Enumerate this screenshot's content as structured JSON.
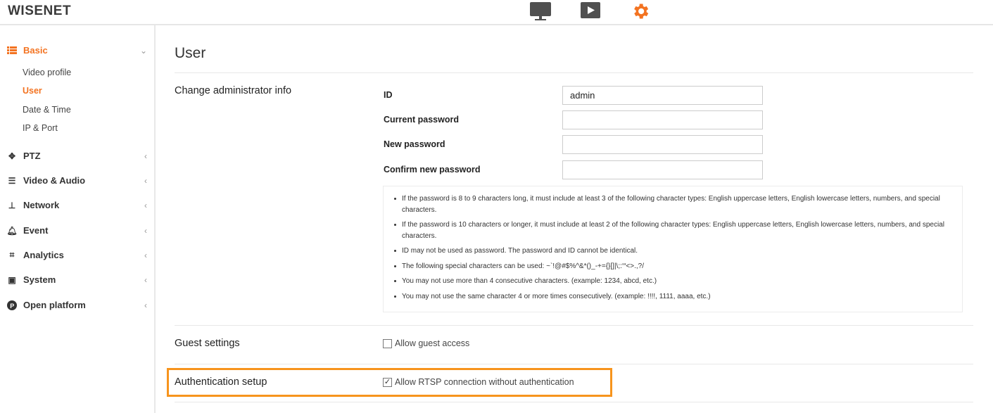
{
  "header": {
    "logo": "WISENET",
    "icons": [
      "monitor-icon",
      "play-icon",
      "gear-icon"
    ],
    "accent": "#f37321"
  },
  "sidebar": {
    "menus": [
      {
        "label": "Basic",
        "icon": "list-icon",
        "expanded": true,
        "items": [
          {
            "label": "Video profile"
          },
          {
            "label": "User",
            "active": true
          },
          {
            "label": "Date & Time"
          },
          {
            "label": "IP & Port"
          }
        ]
      },
      {
        "label": "PTZ",
        "icon": "move-icon"
      },
      {
        "label": "Video & Audio",
        "icon": "sliders-icon"
      },
      {
        "label": "Network",
        "icon": "network-icon"
      },
      {
        "label": "Event",
        "icon": "bell-icon"
      },
      {
        "label": "Analytics",
        "icon": "analytics-icon"
      },
      {
        "label": "System",
        "icon": "system-icon"
      },
      {
        "label": "Open platform",
        "icon": "platform-icon"
      }
    ]
  },
  "main": {
    "title": "User",
    "admin": {
      "section": "Change administrator info",
      "fields": [
        {
          "label": "ID",
          "value": "admin"
        },
        {
          "label": "Current password",
          "value": ""
        },
        {
          "label": "New password",
          "value": ""
        },
        {
          "label": "Confirm new password",
          "value": ""
        }
      ],
      "notes": [
        "If the password is 8 to 9 characters long, it must include at least 3 of the following character types: English uppercase letters, English lowercase letters, numbers, and special characters.",
        "If the password is 10 characters or longer, it must include at least 2 of the following character types: English uppercase letters, English lowercase letters, numbers, and special characters.",
        "ID may not be used as password. The password and ID cannot be identical.",
        "The following special characters can be used: ~`!@#$%^&*()_-+={}[]|\\;:‘“<>.,?/",
        "You may not use more than 4 consecutive characters. (example: 1234, abcd, etc.)",
        "You may not use the same character 4 or more times consecutively. (example: !!!!, 1111, aaaa, etc.)"
      ]
    },
    "guest": {
      "section": "Guest settings",
      "checkbox": "Allow guest access",
      "checked": false
    },
    "auth": {
      "section": "Authentication setup",
      "checkbox": "Allow RTSP connection without authentication",
      "checked": true,
      "check_mark": "✓"
    }
  }
}
